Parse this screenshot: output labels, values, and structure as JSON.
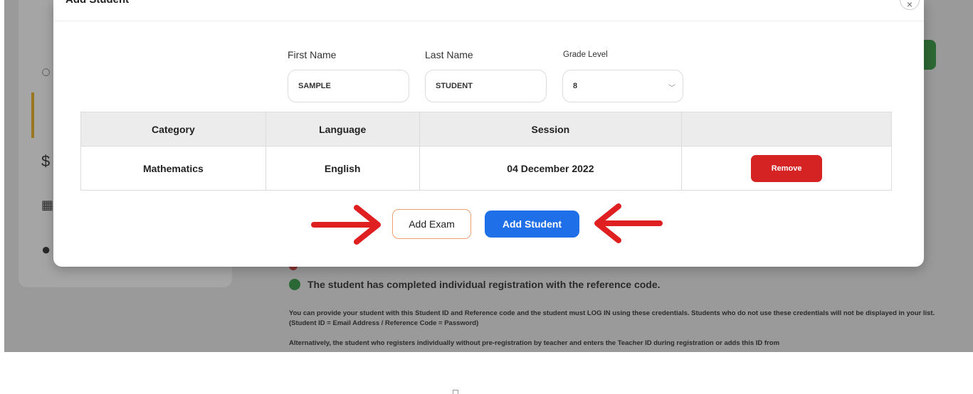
{
  "background": {
    "main_status": "The student has completed individual registration with the reference code.",
    "paragraph_1": "You can provide your student with this Student ID and Reference code and the student must LOG IN using these credentials. Students who do not use these credentials will not be displayed in your list. (Student ID = Email Address / Reference Code = Password)",
    "paragraph_2": "Alternatively, the student who registers individually without pre-registration by teacher and enters the Teacher ID during registration or adds this ID from"
  },
  "modal": {
    "title": "Add Student",
    "close_icon": "×",
    "fields": {
      "first_name_label": "First Name",
      "first_name_value": "SAMPLE",
      "last_name_label": "Last Name",
      "last_name_value": "STUDENT",
      "grade_label": "Grade Level",
      "grade_value": "8"
    },
    "table": {
      "headers": [
        "Category",
        "Language",
        "Session",
        ""
      ],
      "rows": [
        {
          "category": "Mathematics",
          "language": "English",
          "session": "04 December 2022",
          "action": "Remove"
        }
      ]
    },
    "buttons": {
      "add_exam": "Add Exam",
      "add_student": "Add Student"
    }
  },
  "colors": {
    "primary": "#1f6fe8",
    "danger": "#d52323",
    "arrow": "#e02020",
    "success": "#2e8b3d"
  }
}
